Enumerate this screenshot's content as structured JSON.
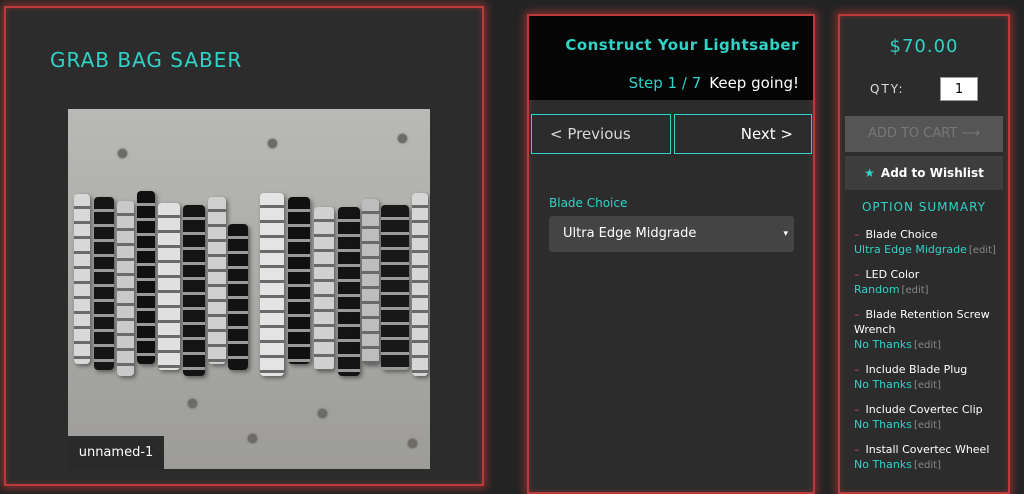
{
  "product": {
    "title": "GRAB BAG SABER",
    "image_caption": "unnamed-1"
  },
  "builder": {
    "title": "Construct Your Lightsaber",
    "step": "Step 1 / 7",
    "encourage": "Keep going!",
    "prev_label": "< Previous",
    "next_label": "Next >",
    "field_label": "Blade Choice",
    "field_value": "Ultra Edge Midgrade",
    "caret": "▾"
  },
  "cart": {
    "price": "$70.00",
    "qty_label": "QTY:",
    "qty_value": "1",
    "add_to_cart": "ADD TO CART ⟶",
    "wishlist": "Add to Wishlist",
    "wishlist_icon": "★"
  },
  "summary": {
    "title": "OPTION SUMMARY",
    "edit_label": "[edit]",
    "items": [
      {
        "name": "Blade Choice",
        "value": "Ultra Edge Midgrade"
      },
      {
        "name": "LED Color",
        "value": "Random"
      },
      {
        "name": "Blade Retention Screw Wrench",
        "value": "No Thanks"
      },
      {
        "name": "Include Blade Plug",
        "value": "No Thanks"
      },
      {
        "name": "Include Covertec Clip",
        "value": "No Thanks"
      },
      {
        "name": "Install Covertec Wheel",
        "value": "No Thanks"
      }
    ]
  },
  "colors": {
    "accent": "#2fd3c7",
    "panel_border": "#b83a3a",
    "background": "#242424"
  }
}
